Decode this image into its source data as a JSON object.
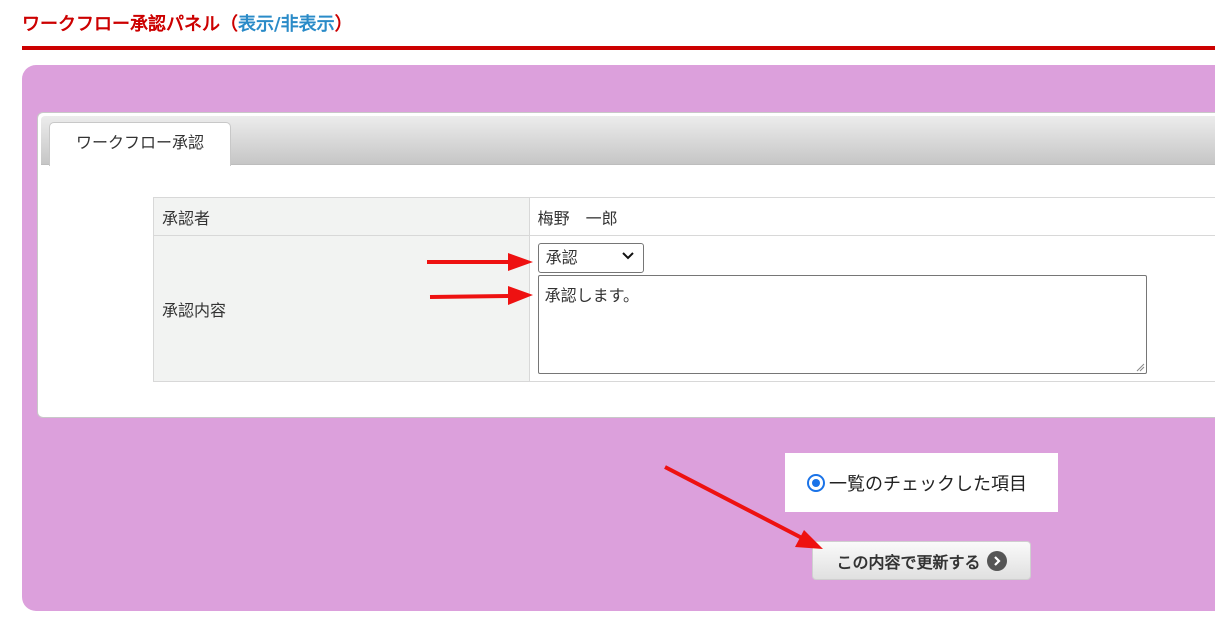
{
  "header": {
    "title": "ワークフロー承認パネル",
    "paren_open": "（",
    "toggle_label": "表示/非表示",
    "paren_close": "）"
  },
  "tabs": [
    {
      "label": "ワークフロー承認"
    }
  ],
  "form": {
    "approver_label": "承認者",
    "approver_value": "梅野　一郎",
    "content_label": "承認内容",
    "decision_selected": "承認",
    "comment_value": "承認します。"
  },
  "radio_option": {
    "label": "一覧のチェックした項目",
    "checked": true
  },
  "update_button": {
    "label": "この内容で更新する"
  },
  "colors": {
    "header_red": "#cc0000",
    "toggle_blue": "#2a8bc8",
    "panel_pink": "#dca0dc",
    "annotation_arrow": "#ee1111",
    "radio_blue": "#1a73e8"
  }
}
